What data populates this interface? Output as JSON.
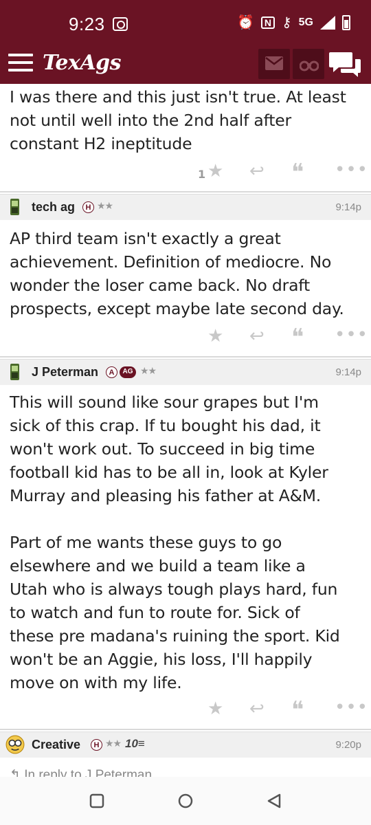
{
  "status_bar": {
    "time": "9:23",
    "network": "5G",
    "icons": [
      "camera-icon",
      "alarm-icon",
      "nfc-icon",
      "key-icon",
      "signal-icon",
      "battery-icon"
    ]
  },
  "app": {
    "title": "TexAgs",
    "brand_color": "#6a1324",
    "header_icons": [
      "menu-icon",
      "mail-icon",
      "binoculars-icon",
      "chat-icon"
    ]
  },
  "posts": [
    {
      "body": "I was there and this just isn't true. At least\nnot until well into the 2nd half after\nconstant H2 ineptitude",
      "like_count": "1"
    },
    {
      "author": "tech ag",
      "badge": "H",
      "stars": "★★",
      "time": "9:14p",
      "body": "AP third team isn't exactly a great\nachievement. Definition of mediocre. No\nwonder the loser came back. No draft\nprospects, except maybe late second day."
    },
    {
      "author": "J Peterman",
      "badge": "A",
      "badge2": "AG",
      "stars": "★★",
      "time": "9:14p",
      "body": "This will sound like sour grapes but I'm\nsick of this crap. If tu bought his dad, it\nwon't work out. To succeed in big time\nfootball kid has to be all in, look at Kyler\nMurray and pleasing his father at A&M.\n\nPart of me wants these guys to go\nelsewhere and we build a team like a\nUtah who is always tough plays hard, fun\nto watch and fun to route for. Sick of\nthese pre madana's ruining the sport. Kid\nwon't be an Aggie, his loss, I'll happily\nmove on with my life."
    },
    {
      "author": "Creative",
      "badge": "H",
      "stars": "★★",
      "rank": "10",
      "time": "9:20p",
      "reply_to": "In reply to J Peterman"
    }
  ],
  "nav": [
    "recents-icon",
    "home-icon",
    "back-icon"
  ]
}
